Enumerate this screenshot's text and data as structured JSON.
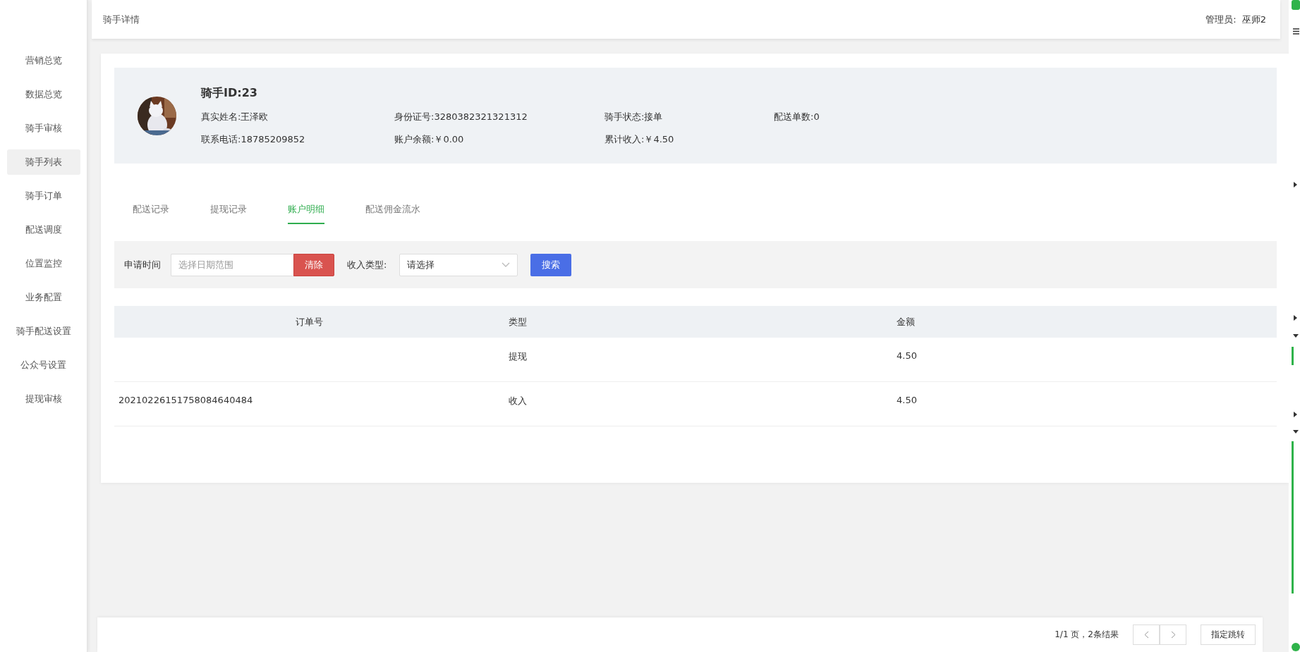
{
  "sidebar": {
    "items": [
      {
        "label": "营销总览",
        "selected": false
      },
      {
        "label": "数据总览",
        "selected": false
      },
      {
        "label": "骑手审核",
        "selected": false
      },
      {
        "label": "骑手列表",
        "selected": true
      },
      {
        "label": "骑手订单",
        "selected": false
      },
      {
        "label": "配送调度",
        "selected": false
      },
      {
        "label": "位置监控",
        "selected": false
      },
      {
        "label": "业务配置",
        "selected": false
      },
      {
        "label": "骑手配送设置",
        "selected": false
      },
      {
        "label": "公众号设置",
        "selected": false
      },
      {
        "label": "提现审核",
        "selected": false
      }
    ]
  },
  "header": {
    "title": "骑手详情",
    "admin_label": "管理员:",
    "admin_name": "巫师2"
  },
  "profile": {
    "title": "骑手ID:23",
    "fields": [
      {
        "text": "真实姓名:王泽欧"
      },
      {
        "text": "身份证号:3280382321321312"
      },
      {
        "text": "骑手状态:接单"
      },
      {
        "text": "配送单数:0"
      },
      {
        "text": "联系电话:18785209852"
      },
      {
        "text": "账户余额:￥0.00"
      },
      {
        "text": "累计收入:￥4.50"
      }
    ]
  },
  "tabs": [
    {
      "label": "配送记录",
      "selected": false
    },
    {
      "label": "提现记录",
      "selected": false
    },
    {
      "label": "账户明细",
      "selected": true
    },
    {
      "label": "配送佣金流水",
      "selected": false
    }
  ],
  "filter": {
    "date_label": "申请时间",
    "date_placeholder": "选择日期范围",
    "clear_button": "清除",
    "type_label": "收入类型:",
    "type_value": "请选择",
    "search_button": "搜索"
  },
  "table": {
    "columns": [
      "订单号",
      "类型",
      "金额"
    ],
    "rows": [
      [
        "",
        "提现",
        "4.50"
      ],
      [
        "20210226151758084640484",
        "收入",
        "4.50"
      ]
    ]
  },
  "pagination": {
    "summary": "1/1 页，2条结果",
    "jump_button": "指定跳转"
  }
}
